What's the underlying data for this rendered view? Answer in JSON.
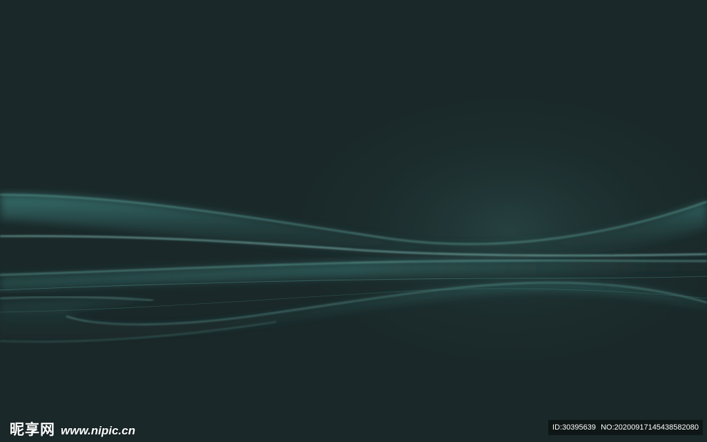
{
  "watermark": {
    "brand": "昵享网",
    "url": "www.nipic.cn",
    "id_text": "ID:30395639",
    "no_text": "NO:20200917145438582080"
  },
  "colors": {
    "background": "#1a2829",
    "wave_highlight": "#8fe0d6",
    "wave_mid": "#3e8a86",
    "wave_dark": "#213637"
  }
}
